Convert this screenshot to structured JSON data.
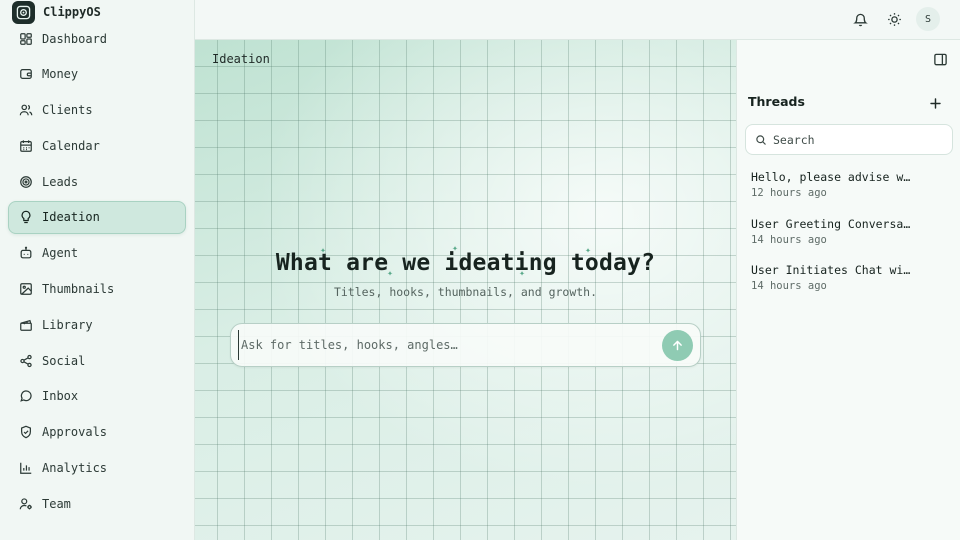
{
  "app": {
    "name": "ClippyOS"
  },
  "sidebar": {
    "items": [
      {
        "label": "Dashboard",
        "icon": "layout-grid-icon"
      },
      {
        "label": "Money",
        "icon": "wallet-icon"
      },
      {
        "label": "Clients",
        "icon": "users-icon"
      },
      {
        "label": "Calendar",
        "icon": "calendar-icon"
      },
      {
        "label": "Leads",
        "icon": "target-icon"
      },
      {
        "label": "Ideation",
        "icon": "lightbulb-icon",
        "active": true
      },
      {
        "label": "Agent",
        "icon": "bot-icon"
      },
      {
        "label": "Thumbnails",
        "icon": "image-icon"
      },
      {
        "label": "Library",
        "icon": "clapperboard-icon"
      },
      {
        "label": "Social",
        "icon": "share-icon"
      },
      {
        "label": "Inbox",
        "icon": "message-circle-icon"
      },
      {
        "label": "Approvals",
        "icon": "shield-check-icon"
      },
      {
        "label": "Analytics",
        "icon": "bar-chart-icon"
      },
      {
        "label": "Team",
        "icon": "user-cog-icon"
      }
    ]
  },
  "topbar": {
    "avatar_initial": "S",
    "icons": [
      "bell-icon",
      "sun-icon"
    ]
  },
  "main": {
    "section_label": "Ideation",
    "title": "What are we ideating today?",
    "subtitle": "Titles, hooks, thumbnails, and growth.",
    "prompt_placeholder": "Ask for titles, hooks, angles…"
  },
  "threads": {
    "heading": "Threads",
    "search_placeholder": "Search",
    "items": [
      {
        "title": "Hello, please advise wha…",
        "time": "12 hours ago"
      },
      {
        "title": "User Greeting Conversati…",
        "time": "14 hours ago"
      },
      {
        "title": "User Initiates Chat with…",
        "time": "14 hours ago"
      }
    ]
  },
  "colors": {
    "accent": "#8fcbb3",
    "active_nav_bg": "#cfe8de",
    "canvas_bg": "#dcefe6"
  }
}
